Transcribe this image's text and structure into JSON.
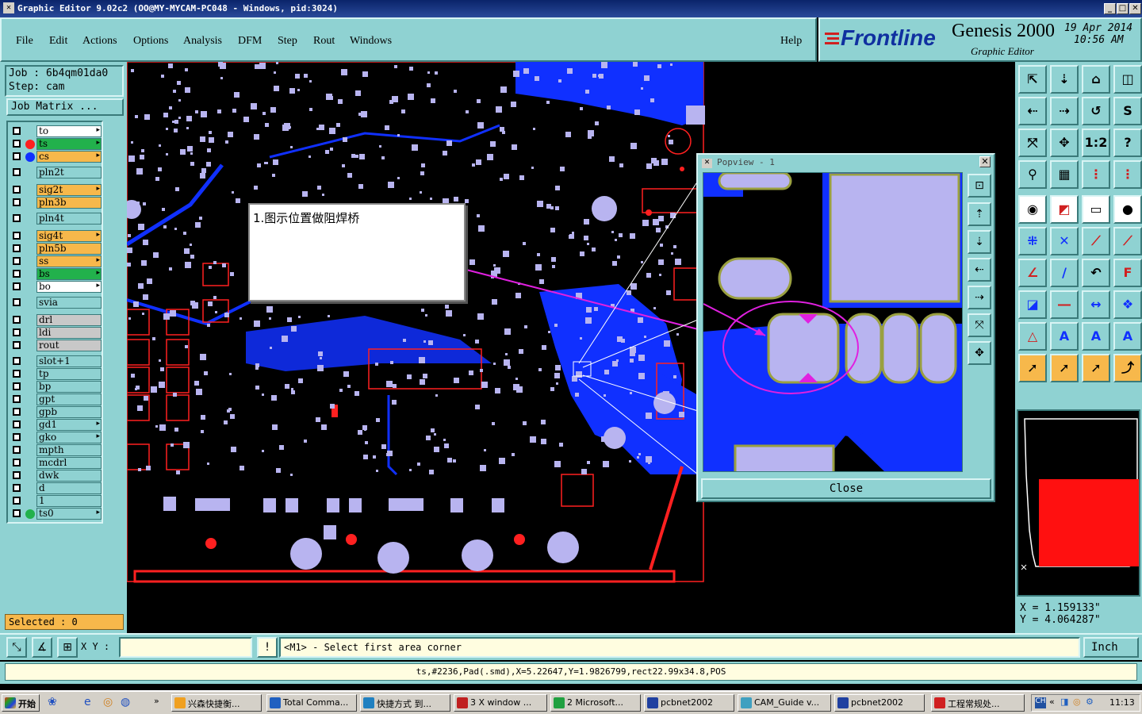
{
  "window": {
    "title": "Graphic Editor 9.02c2  (OO@MY-MYCAM-PC048 - Windows, pid:3024)"
  },
  "menu": [
    "File",
    "Edit",
    "Actions",
    "Options",
    "Analysis",
    "DFM",
    "Step",
    "Rout",
    "Windows"
  ],
  "help": "Help",
  "brand": {
    "logo": "Frontline",
    "product": "Genesis 2000",
    "subtitle": "Graphic Editor",
    "date": "19 Apr 2014",
    "time": "10:56 AM"
  },
  "job": {
    "job_label": "Job  :  6b4qm01da0",
    "step_label": "Step:  cam",
    "matrix_button": "Job Matrix ..."
  },
  "layers": [
    {
      "name": "to",
      "bg": "#ffffff",
      "dot": "",
      "arrow": "▸"
    },
    {
      "name": "ts",
      "bg": "#22b14c",
      "dot": "#ff2020",
      "arrow": "▸"
    },
    {
      "name": "cs",
      "bg": "#f7b84b",
      "dot": "#1030ff",
      "arrow": "▸"
    },
    {
      "name": "pln2t",
      "bg": "#8fd2d2",
      "dot": "",
      "arrow": ""
    },
    {
      "name": "sig2t",
      "bg": "#f7b84b",
      "dot": "",
      "arrow": "▸"
    },
    {
      "name": "pln3b",
      "bg": "#f7b84b",
      "dot": "",
      "arrow": ""
    },
    {
      "name": "pln4t",
      "bg": "#8fd2d2",
      "dot": "",
      "arrow": ""
    },
    {
      "name": "sig4t",
      "bg": "#f7b84b",
      "dot": "",
      "arrow": "▸"
    },
    {
      "name": "pln5b",
      "bg": "#f7b84b",
      "dot": "",
      "arrow": ""
    },
    {
      "name": "ss",
      "bg": "#f7b84b",
      "dot": "",
      "arrow": "▸"
    },
    {
      "name": "bs",
      "bg": "#22b14c",
      "dot": "",
      "arrow": "▸"
    },
    {
      "name": "bo",
      "bg": "#ffffff",
      "dot": "",
      "arrow": "▸"
    },
    {
      "name": "svia",
      "bg": "#8fd2d2",
      "dot": "",
      "arrow": ""
    },
    {
      "name": "drl",
      "bg": "#c8c8c8",
      "dot": "",
      "arrow": ""
    },
    {
      "name": "ldi",
      "bg": "#c8c8c8",
      "dot": "",
      "arrow": ""
    },
    {
      "name": "rout",
      "bg": "#c8c8c8",
      "dot": "",
      "arrow": ""
    },
    {
      "name": "slot+1",
      "bg": "#8fd2d2",
      "dot": "",
      "arrow": ""
    },
    {
      "name": "tp",
      "bg": "#8fd2d2",
      "dot": "",
      "arrow": ""
    },
    {
      "name": "bp",
      "bg": "#8fd2d2",
      "dot": "",
      "arrow": ""
    },
    {
      "name": "gpt",
      "bg": "#8fd2d2",
      "dot": "",
      "arrow": ""
    },
    {
      "name": "gpb",
      "bg": "#8fd2d2",
      "dot": "",
      "arrow": ""
    },
    {
      "name": "gd1",
      "bg": "#8fd2d2",
      "dot": "",
      "arrow": "▸"
    },
    {
      "name": "gko",
      "bg": "#8fd2d2",
      "dot": "",
      "arrow": "▸"
    },
    {
      "name": "mpth",
      "bg": "#8fd2d2",
      "dot": "",
      "arrow": ""
    },
    {
      "name": "mcdrl",
      "bg": "#8fd2d2",
      "dot": "",
      "arrow": ""
    },
    {
      "name": "dwk",
      "bg": "#8fd2d2",
      "dot": "",
      "arrow": ""
    },
    {
      "name": "d",
      "bg": "#8fd2d2",
      "dot": "",
      "arrow": ""
    },
    {
      "name": "1",
      "bg": "#8fd2d2",
      "dot": "",
      "arrow": ""
    },
    {
      "name": "ts0",
      "bg": "#8fd2d2",
      "dot": "#22b14c",
      "arrow": "▸"
    }
  ],
  "selected": "Selected : 0",
  "callout": "1.图示位置做阻焊桥",
  "popview": {
    "title": "Popview - 1",
    "close": "Close"
  },
  "coords": {
    "x": "X = 1.159133\"",
    "y": "Y = 4.064287\""
  },
  "command": {
    "xy_label": "X Y :",
    "xy_value": "",
    "prompt": "<M1> - Select first area corner",
    "unit": "Inch"
  },
  "status": "ts,#2236,Pad(.smd),X=5.22647,Y=1.9826799,rect22.99x34.8,POS",
  "taskbar": {
    "start": "开始",
    "tasks": [
      "兴森快捷衡...",
      "Total Comma...",
      "快捷方式 到...",
      "3 X window ...",
      "2 Microsoft...",
      "pcbnet2002",
      "CAM_Guide v...",
      "pcbnet2002",
      "工程常规处..."
    ],
    "clock": "11:13"
  },
  "colors": {
    "panel": "#8fd2d2",
    "copper": "#1030ff",
    "pad": "#b8b4f0",
    "outline": "#ff2020",
    "highlight": "#f7b84b"
  }
}
